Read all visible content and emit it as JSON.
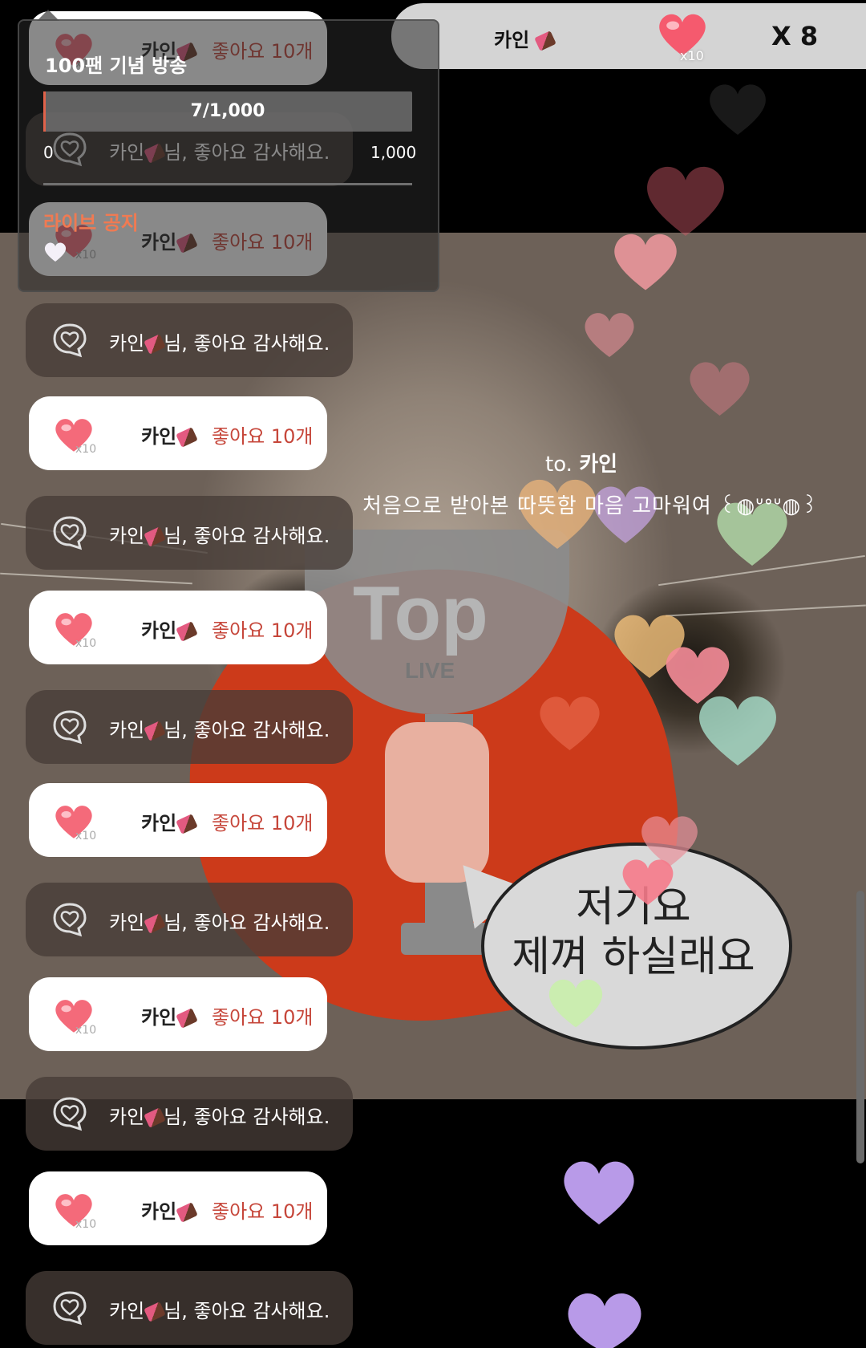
{
  "top_banner": {
    "sender": "카인",
    "badge": "x10",
    "count": "X 8"
  },
  "info_panel": {
    "title": "100팬 기념 방송",
    "progress_label": "7/1,000",
    "progress_value": 7,
    "progress_max": 1000,
    "min_label": "0",
    "max_label": "1,000",
    "notice_title": "라이브 공지"
  },
  "message": {
    "to_prefix": "to.",
    "to_name": "카인",
    "body": "처음으로 받아본 따뜻함 마음 고마워여 ꒰◍ᐡᐤᐡ◍꒱"
  },
  "stream_art": {
    "trophy_text": "Top",
    "trophy_sub": "LIVE",
    "bubble_line1": "저기요",
    "bubble_line2": "제껴 하실래요"
  },
  "chat": [
    {
      "type": "like",
      "name": "카인",
      "text": "좋아요 10개",
      "badge": "x10"
    },
    {
      "type": "thanks",
      "name": "카인",
      "text": "님, 좋아요 감사해요."
    },
    {
      "type": "like",
      "name": "카인",
      "text": "좋아요 10개",
      "badge": "x10"
    },
    {
      "type": "thanks",
      "name": "카인",
      "text": "님, 좋아요 감사해요."
    },
    {
      "type": "like",
      "name": "카인",
      "text": "좋아요 10개",
      "badge": "x10"
    },
    {
      "type": "thanks",
      "name": "카인",
      "text": "님, 좋아요 감사해요."
    },
    {
      "type": "like",
      "name": "카인",
      "text": "좋아요 10개",
      "badge": "x10"
    },
    {
      "type": "thanks",
      "name": "카인",
      "text": "님, 좋아요 감사해요."
    },
    {
      "type": "like",
      "name": "카인",
      "text": "좋아요 10개",
      "badge": "x10"
    },
    {
      "type": "thanks",
      "name": "카인",
      "text": "님, 좋아요 감사해요."
    },
    {
      "type": "like",
      "name": "카인",
      "text": "좋아요 10개",
      "badge": "x10"
    },
    {
      "type": "thanks",
      "name": "카인",
      "text": "님, 좋아요 감사해요."
    },
    {
      "type": "like",
      "name": "카인",
      "text": "좋아요 10개",
      "badge": "x10"
    },
    {
      "type": "thanks",
      "name": "카인",
      "text": "님, 좋아요 감사해요."
    }
  ],
  "colors": {
    "accent": "#e0624a",
    "like_text": "#c6463a",
    "notice": "#f07a52"
  }
}
